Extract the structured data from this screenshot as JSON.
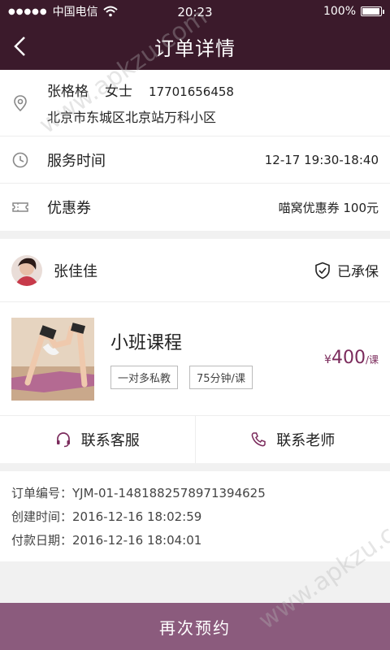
{
  "status": {
    "carrier": "中国电信",
    "time": "20:23",
    "battery": "100%",
    "battery_level": 1.0
  },
  "nav": {
    "title": "订单详情"
  },
  "address": {
    "name": "张格格",
    "title": "女士",
    "phone": "17701656458",
    "address": "北京市东城区北京站万科小区"
  },
  "service_time": {
    "label": "服务时间",
    "value": "12-17  19:30-18:40"
  },
  "coupon": {
    "label": "优惠券",
    "value": "喵窝优惠券  100元"
  },
  "teacher": {
    "name": "张佳佳",
    "insured": "已承保"
  },
  "course": {
    "title": "小班课程",
    "tags": [
      "一对多私教",
      "75分钟/课"
    ],
    "price_currency": "¥",
    "price": "400",
    "price_unit": "/课"
  },
  "contact": {
    "service": "联系客服",
    "teacher": "联系老师"
  },
  "order": {
    "number": "订单编号：YJM-01-1481882578971394625",
    "created": "创建时间：2016-12-16  18:02:59",
    "paid": "付款日期：2016-12-16  18:04:01"
  },
  "action": {
    "rebook": "再次预约"
  },
  "watermark": "www.apkzu.com",
  "colors": {
    "header": "#3b1a2b",
    "accent": "#7b2b5c",
    "button": "#8b5b7d"
  }
}
